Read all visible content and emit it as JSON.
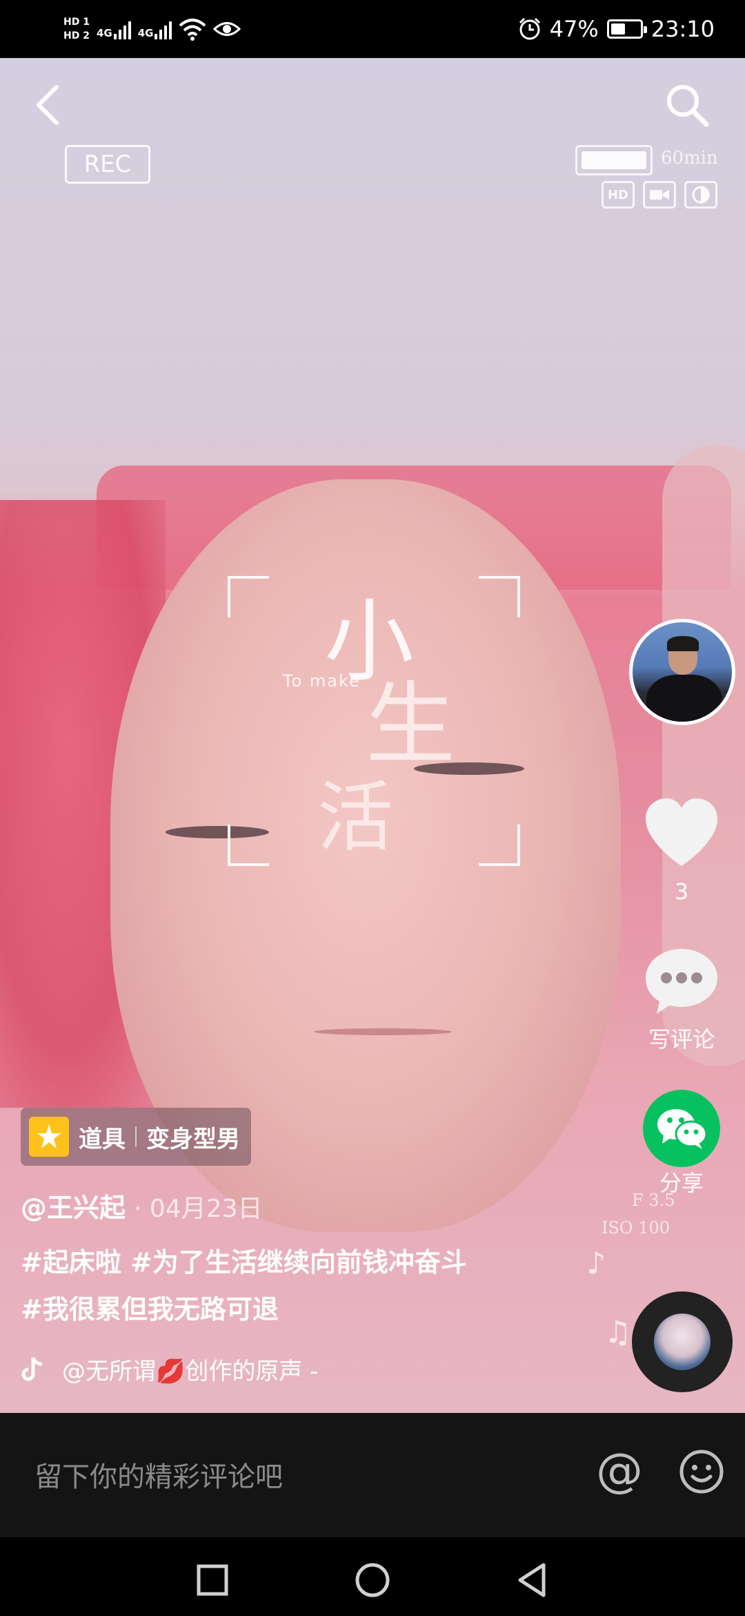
{
  "status_bar": {
    "hd1": "HD 1",
    "hd2": "HD 2",
    "net1": "4G",
    "net2": "4G",
    "battery": "47%",
    "time": "23:10"
  },
  "video_overlay": {
    "rec": "REC",
    "duration": "60min",
    "hd": "HD",
    "to_make": "To make",
    "char1": "小",
    "char2": "生",
    "char3": "活",
    "aperture": "F 3.5",
    "iso": "ISO 100"
  },
  "post": {
    "prop_label": "道具",
    "prop_name": "变身型男",
    "author": "@王兴起",
    "date": "· 04月23日",
    "caption_line1": "#起床啦 #为了生活继续向前钱冲奋斗",
    "caption_line2": "#我很累但我无路可退",
    "music": "@无所谓💋创作的原声 -"
  },
  "actions": {
    "like_count": "3",
    "comment_label": "写评论",
    "share_label": "分享"
  },
  "comment_bar": {
    "placeholder": "留下你的精彩评论吧",
    "at": "@"
  },
  "colors": {
    "share_green": "#07c160",
    "prop_yellow": "#ffc21a"
  },
  "icons": [
    "back-icon",
    "search-icon",
    "heart-icon",
    "comment-icon",
    "wechat-icon",
    "music-note-icon",
    "tiktok-icon",
    "emoji-icon",
    "nav-square-icon",
    "nav-circle-icon",
    "nav-back-icon"
  ]
}
